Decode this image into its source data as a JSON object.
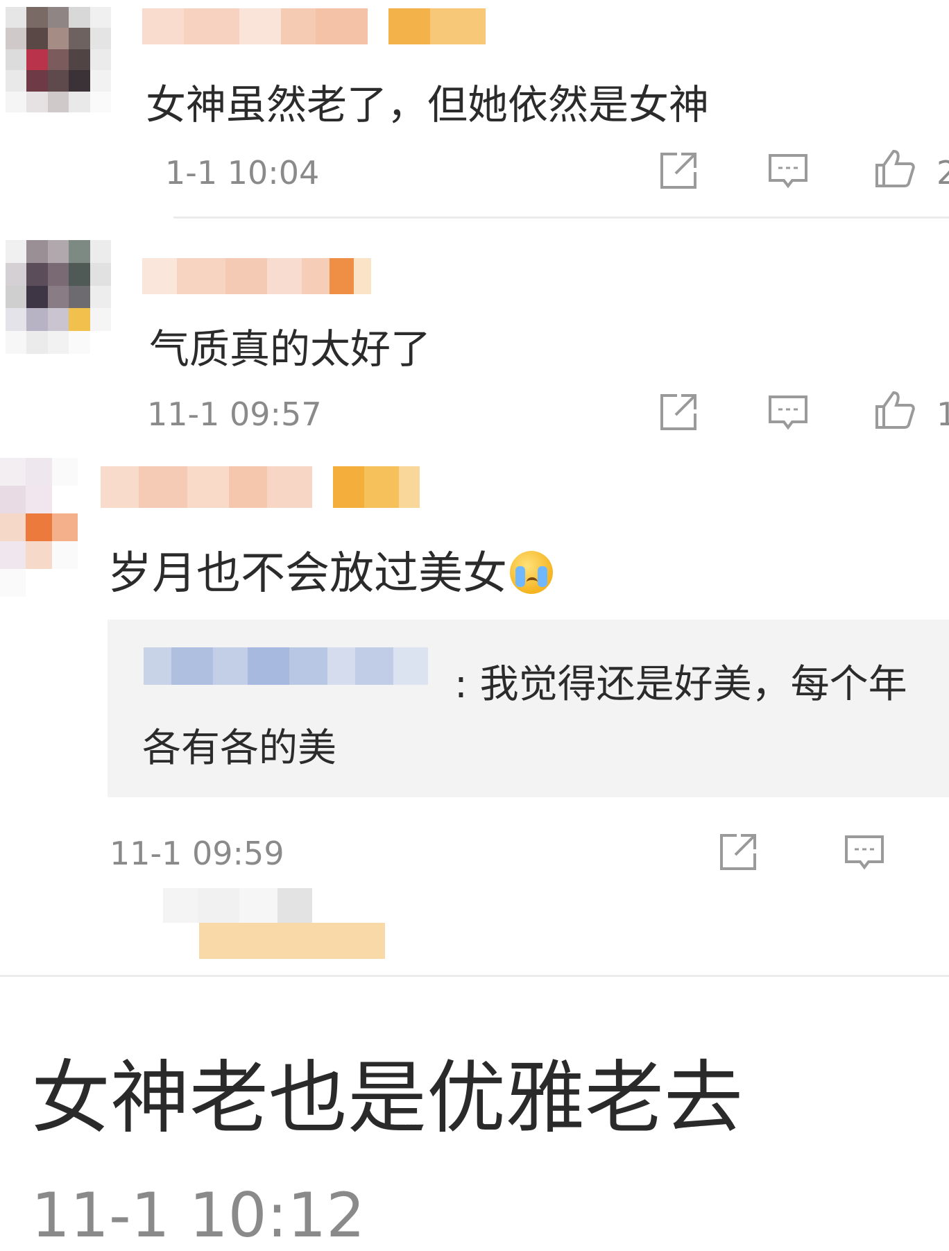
{
  "comments": [
    {
      "text": "女神虽然老了，但她依然是女神",
      "time": "1-1 10:04",
      "likes": "2"
    },
    {
      "text": "气质真的太好了",
      "time": "11-1 09:57",
      "likes": "1"
    },
    {
      "text": "岁月也不会放过美女",
      "emoji": "crying-face-emoji",
      "time": "11-1 09:59",
      "reply": {
        "line1": ": 我觉得还是好美，每个年",
        "line2": "各有各的美"
      }
    },
    {
      "text": "女神老也是优雅老去",
      "time": "11-1 10:12"
    }
  ],
  "colors": {
    "text": "#2b2b2b",
    "time": "#8a8a8a",
    "icon": "#9a9a9a",
    "reply_bg": "#f3f3f3"
  }
}
